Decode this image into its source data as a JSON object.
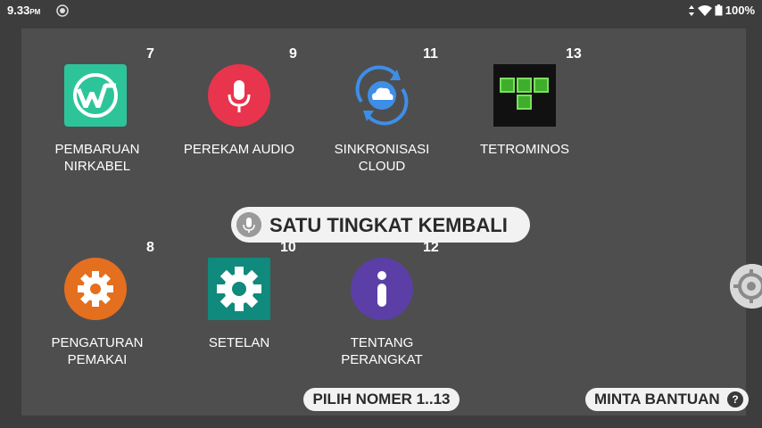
{
  "status": {
    "time": "9.33",
    "ampm": "PM",
    "battery": "100%"
  },
  "apps": [
    {
      "number": "7",
      "label1": "PEMBARUAN",
      "label2": "NIRKABEL",
      "icon": "wireless-update-icon"
    },
    {
      "number": "9",
      "label1": "PEREKAM AUDIO",
      "label2": "",
      "icon": "microphone-icon"
    },
    {
      "number": "11",
      "label1": "SINKRONISASI",
      "label2": "CLOUD",
      "icon": "cloud-sync-icon"
    },
    {
      "number": "13",
      "label1": "TETROMINOS",
      "label2": "",
      "icon": "tetromino-icon"
    },
    {
      "number": "8",
      "label1": "PENGATURAN",
      "label2": "PEMAKAI",
      "icon": "user-settings-gear-icon"
    },
    {
      "number": "10",
      "label1": "SETELAN",
      "label2": "",
      "icon": "settings-gear-icon"
    },
    {
      "number": "12",
      "label1": "TENTANG",
      "label2": "PERANGKAT",
      "icon": "info-icon"
    }
  ],
  "voice_prompt": "SATU TINGKAT KEMBALI",
  "pick_number": "PILIH NOMER 1..13",
  "help": {
    "label": "MINTA BANTUAN",
    "icon_text": "?"
  },
  "colors": {
    "wireless": "#2ec49a",
    "mic": "#e9344d",
    "cloud": "#3e8ee8",
    "user_gear": "#e46f1e",
    "settings": "#0f8a7c",
    "info": "#5b3fa6"
  }
}
